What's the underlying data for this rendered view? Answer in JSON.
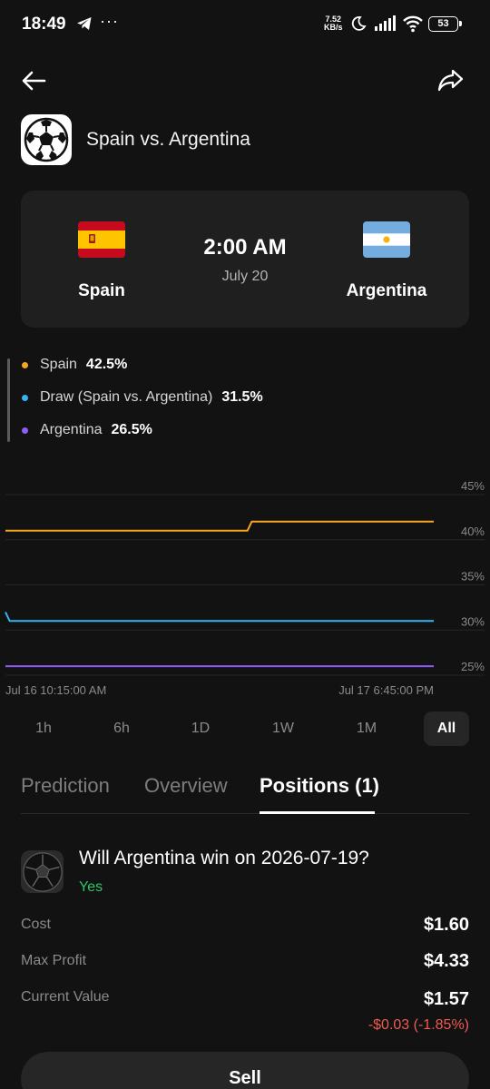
{
  "status_bar": {
    "time": "18:49",
    "net_speed_value": "7.52",
    "net_speed_unit": "KB/s",
    "battery": "53"
  },
  "event": {
    "title": "Spain vs. Argentina"
  },
  "match": {
    "home_team": "Spain",
    "away_team": "Argentina",
    "time": "2:00 AM",
    "date": "July 20"
  },
  "legend": [
    {
      "name": "Spain",
      "value": "42.5%",
      "color": "#f5a623"
    },
    {
      "name": "Draw (Spain vs. Argentina)",
      "value": "31.5%",
      "color": "#35b5f0"
    },
    {
      "name": "Argentina",
      "value": "26.5%",
      "color": "#8e5cf7"
    }
  ],
  "chart_data": {
    "type": "line",
    "x_start": "Jul 16 10:15:00 AM",
    "x_end": "Jul 17 6:45:00 PM",
    "y_ticks": [
      "45%",
      "40%",
      "35%",
      "30%",
      "25%"
    ],
    "ylim": [
      25,
      45
    ],
    "grid": true,
    "series": [
      {
        "name": "Spain",
        "color": "#f5a623",
        "points": [
          [
            0,
            41
          ],
          [
            0.565,
            41
          ],
          [
            0.575,
            42
          ],
          [
            1,
            42
          ]
        ]
      },
      {
        "name": "Draw (Spain vs. Argentina)",
        "color": "#35b5f0",
        "points": [
          [
            0,
            32
          ],
          [
            0.01,
            31
          ],
          [
            1,
            31
          ]
        ]
      },
      {
        "name": "Argentina",
        "color": "#8e5cf7",
        "points": [
          [
            0,
            26
          ],
          [
            1,
            26
          ]
        ]
      }
    ]
  },
  "ranges": [
    "1h",
    "6h",
    "1D",
    "1W",
    "1M",
    "All"
  ],
  "active_range": "All",
  "tabs": [
    "Prediction",
    "Overview",
    "Positions (1)"
  ],
  "active_tab": "Positions (1)",
  "position": {
    "question": "Will Argentina win on 2026-07-19?",
    "outcome": "Yes",
    "cost_label": "Cost",
    "cost_value": "$1.60",
    "max_profit_label": "Max Profit",
    "max_profit_value": "$4.33",
    "current_value_label": "Current Value",
    "current_value": "$1.57",
    "change": "-$0.03 (-1.85%)"
  },
  "sell_label": "Sell"
}
